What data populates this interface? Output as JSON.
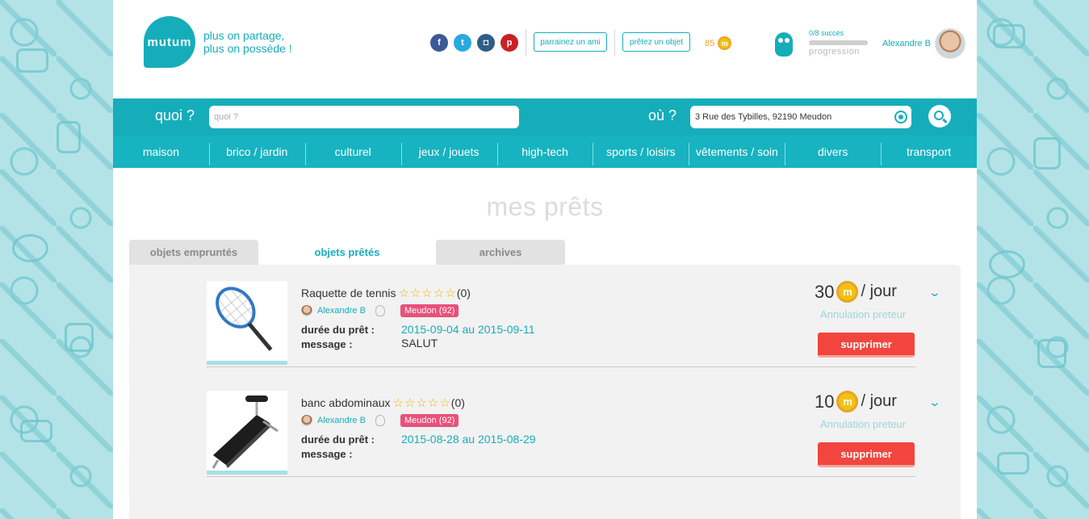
{
  "brand": {
    "logo_text": "mutum",
    "tagline_line1": "plus on partage,",
    "tagline_line2": "plus on possède !"
  },
  "social": [
    {
      "name": "facebook",
      "glyph": "f",
      "color": "#3b5998"
    },
    {
      "name": "twitter",
      "glyph": "t",
      "color": "#29a9e1"
    },
    {
      "name": "instagram",
      "glyph": "◘",
      "color": "#2e5e86"
    },
    {
      "name": "pinterest",
      "glyph": "p",
      "color": "#cb2027"
    }
  ],
  "header": {
    "sponsor_label": "parrainez un ami",
    "lend_label": "prêtez un objet",
    "coins": "85",
    "coin_symbol": "m",
    "succes": "0/8 succès",
    "progression": "progression",
    "user_name": "Alexandre B"
  },
  "search": {
    "what_label": "quoi ?",
    "what_placeholder": "quoi ?",
    "where_label": "où ?",
    "where_value": "3 Rue des Tybilles, 92190 Meudon"
  },
  "categories": [
    "maison",
    "brico / jardin",
    "culturel",
    "jeux / jouets",
    "high-tech",
    "sports / loisirs",
    "vêtements / soin",
    "divers",
    "transport"
  ],
  "page": {
    "title": "mes prêts",
    "tabs": [
      "objets empruntés",
      "objets prêtés",
      "archives"
    ]
  },
  "loans": [
    {
      "name": "Raquette de tennis",
      "stars": "☆☆☆☆☆",
      "rating_count": "(0)",
      "owner": "Alexandre B",
      "city": "Meudon (92)",
      "duration_label": "durée du prêt :",
      "dates": "2015-09-04 au 2015-09-11",
      "message_label": "message :",
      "message": "SALUT",
      "price": "30",
      "unit": "/ jour",
      "status": "Annulation preteur",
      "delete_label": "supprimer",
      "chevron": "⌄"
    },
    {
      "name": "banc abdominaux",
      "stars": "☆☆☆☆☆",
      "rating_count": "(0)",
      "owner": "Alexandre B",
      "city": "Meudon (92)",
      "duration_label": "durée du prêt :",
      "dates": "2015-08-28 au 2015-08-29",
      "message_label": "message :",
      "message": "",
      "price": "10",
      "unit": "/ jour",
      "status": "Annulation preteur",
      "delete_label": "supprimer",
      "chevron": "⌄"
    }
  ],
  "colors": {
    "accent": "#16adbb",
    "delete": "#f2453d",
    "city_badge": "#e8517a",
    "coin": "#f2c114"
  }
}
